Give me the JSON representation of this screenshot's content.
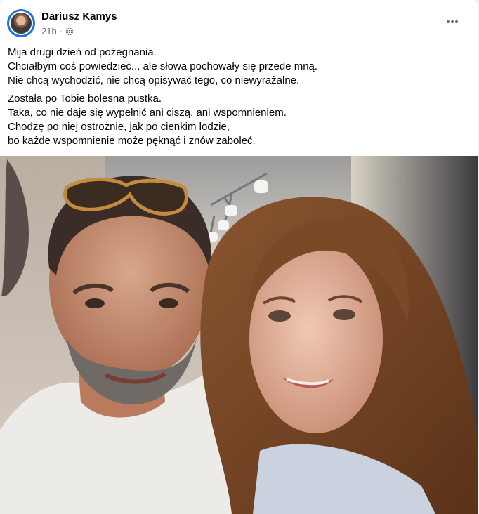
{
  "post": {
    "author": "Dariusz Kamys",
    "time": "21h",
    "separator": "·",
    "more_label": "•••",
    "text_paragraphs": [
      [
        "Mija drugi dzień od pożegnania.",
        "Chciałbym coś powiedzieć... ale słowa pochowały się przede mną.",
        "Nie chcą wychodzić, nie chcą opisywać tego, co niewyrażalne."
      ],
      [
        "Została po Tobie bolesna pustka.",
        "Taka, co nie daje się wypełnić ani ciszą, ani wspomnieniem.",
        "Chodzę po niej ostrożnie, jak po cienkim lodzie,",
        "bo każde wspomnienie może pęknąć i znów zaboleć."
      ]
    ]
  },
  "icons": {
    "globe": "globe-icon",
    "more": "more-horizontal-icon"
  },
  "colors": {
    "author": "#050505",
    "meta": "#65676b",
    "avatar_ring": "#1b74e4"
  }
}
